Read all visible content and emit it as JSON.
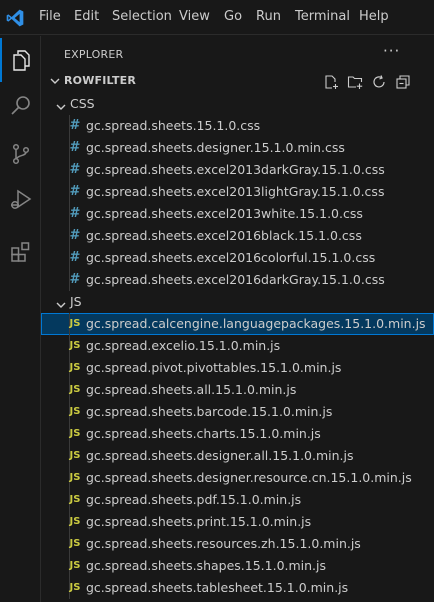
{
  "menu": [
    "File",
    "Edit",
    "Selection",
    "View",
    "Go",
    "Run",
    "Terminal",
    "Help"
  ],
  "sidebar": {
    "title": "EXPLORER",
    "more_label": "···",
    "section": "ROWFILTER",
    "css_folder": {
      "name": "CSS",
      "files": [
        "gc.spread.sheets.15.1.0.css",
        "gc.spread.sheets.designer.15.1.0.min.css",
        "gc.spread.sheets.excel2013darkGray.15.1.0.css",
        "gc.spread.sheets.excel2013lightGray.15.1.0.css",
        "gc.spread.sheets.excel2013white.15.1.0.css",
        "gc.spread.sheets.excel2016black.15.1.0.css",
        "gc.spread.sheets.excel2016colorful.15.1.0.css",
        "gc.spread.sheets.excel2016darkGray.15.1.0.css"
      ]
    },
    "js_folder": {
      "name": "JS",
      "files": [
        "gc.spread.calcengine.languagepackages.15.1.0.min.js",
        "gc.spread.excelio.15.1.0.min.js",
        "gc.spread.pivot.pivottables.15.1.0.min.js",
        "gc.spread.sheets.all.15.1.0.min.js",
        "gc.spread.sheets.barcode.15.1.0.min.js",
        "gc.spread.sheets.charts.15.1.0.min.js",
        "gc.spread.sheets.designer.all.15.1.0.min.js",
        "gc.spread.sheets.designer.resource.cn.15.1.0.min.js",
        "gc.spread.sheets.pdf.15.1.0.min.js",
        "gc.spread.sheets.print.15.1.0.min.js",
        "gc.spread.sheets.resources.zh.15.1.0.min.js",
        "gc.spread.sheets.shapes.15.1.0.min.js",
        "gc.spread.sheets.tablesheet.15.1.0.min.js"
      ]
    },
    "css_icon": "#",
    "js_icon": "JS",
    "selected_file": "gc.spread.calcengine.languagepackages.15.1.0.min.js"
  },
  "colors": {
    "background": "#181818",
    "accent": "#0078d4",
    "selection": "#04395e",
    "css_icon": "#519aba",
    "js_icon": "#cbcb41"
  },
  "icons": [
    "vscode-logo-icon",
    "explorer-icon",
    "search-icon",
    "source-control-icon",
    "run-debug-icon",
    "extensions-icon",
    "new-file-icon",
    "new-folder-icon",
    "refresh-icon",
    "collapse-all-icon",
    "chevron-down-icon"
  ]
}
